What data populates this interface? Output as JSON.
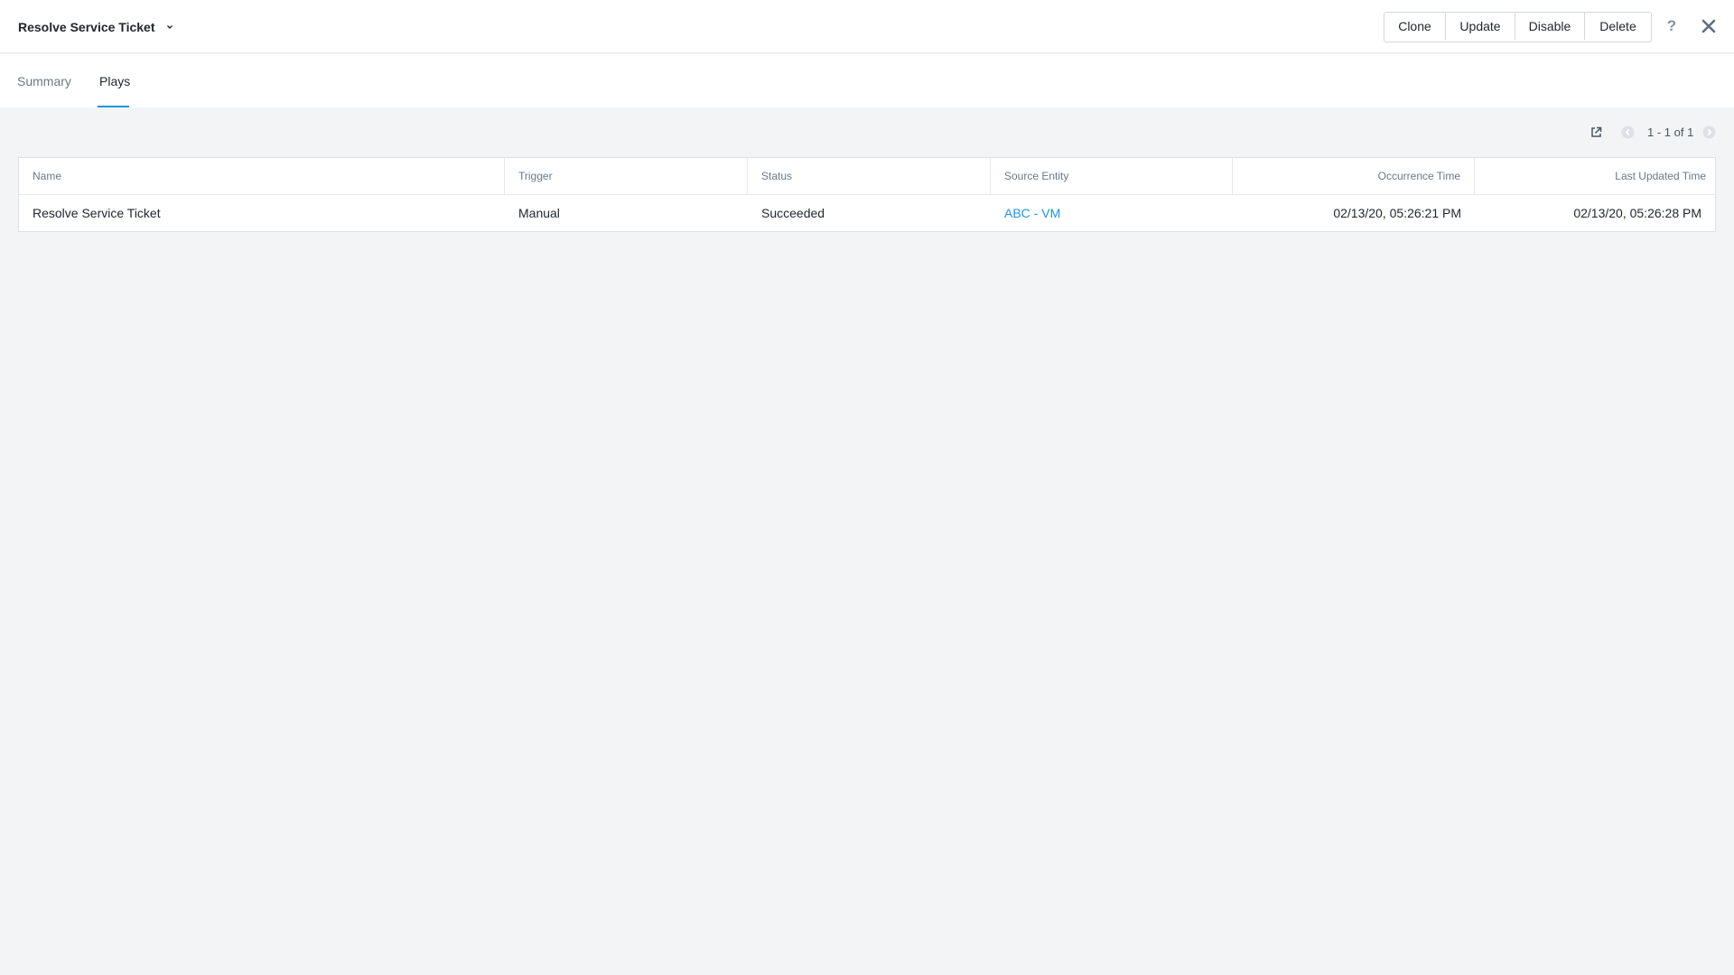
{
  "header": {
    "title": "Resolve Service Ticket",
    "actions": [
      "Clone",
      "Update",
      "Disable",
      "Delete"
    ],
    "help_label": "?"
  },
  "tabs": [
    {
      "label": "Summary",
      "active": false
    },
    {
      "label": "Plays",
      "active": true
    }
  ],
  "pagination": {
    "text": "1 - 1 of 1"
  },
  "table": {
    "columns": [
      "Name",
      "Trigger",
      "Status",
      "Source Entity",
      "Occurrence Time",
      "Last Updated Time"
    ],
    "rows": [
      [
        "Resolve Service Ticket",
        "Manual",
        "Succeeded",
        "ABC - VM",
        "02/13/20, 05:26:21 PM",
        "02/13/20, 05:26:28 PM"
      ]
    ]
  },
  "colors": {
    "accent": "#1b95e0",
    "background": "#f2f4f6",
    "text": "#22272e",
    "muted": "#6b7886"
  },
  "icons": [
    "chevron-down-icon",
    "help-icon",
    "close-icon",
    "open-external-icon",
    "prev-page-icon",
    "next-page-icon"
  ]
}
